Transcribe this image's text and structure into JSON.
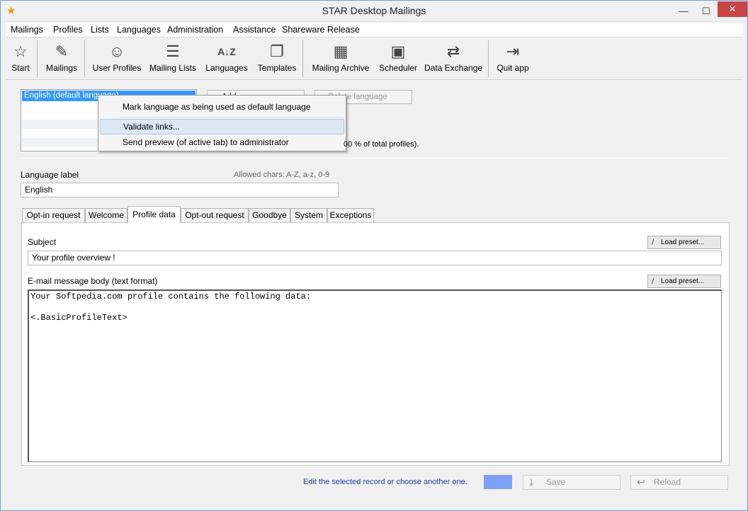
{
  "window": {
    "title": "STAR Desktop Mailings",
    "min_icon": "minimize-icon",
    "max_icon": "maximize-icon",
    "close_icon": "close-icon"
  },
  "menu": [
    "Mailings",
    "Profiles",
    "Lists",
    "Languages",
    "Administration",
    "Assistance",
    "Shareware Release"
  ],
  "toolbar": {
    "start": "Start",
    "mailings": "Mailings",
    "user_profiles": "User Profiles",
    "mailing_lists": "Mailing Lists",
    "languages": "Languages",
    "templates": "Templates",
    "mailing_archive": "Mailing Archive",
    "scheduler": "Scheduler",
    "data_exchange": "Data Exchange",
    "quit_app": "Quit app"
  },
  "language_list": {
    "items": [
      "English (default language)"
    ]
  },
  "buttons": {
    "add_language": "Add",
    "delete_language": "Delete language"
  },
  "context_menu": {
    "items": [
      "Mark language as being used as default language",
      "Validate links...",
      "Send preview (of active tab) to administrator"
    ]
  },
  "profiles_text": "00 % of total profiles).",
  "form": {
    "language_label": "Language label",
    "allowed_chars": "Allowed chars: A-Z, a-z, 0-9",
    "language_value": "English"
  },
  "tabs": [
    "Opt-in request",
    "Welcome",
    "Profile data",
    "Opt-out request",
    "Goodbye",
    "System",
    "Exceptions"
  ],
  "panel": {
    "subject_label": "Subject",
    "subject_value": "Your profile overview !",
    "load_preset": "Load preset...",
    "body_label": "E-mail message body (text format)",
    "body_text": "Your Softpedia.com profile contains the following data:\n\n<.BasicProfileText>"
  },
  "footer": {
    "hint": "Edit the selected record or choose another one.",
    "save": "Save",
    "reload": "Reload",
    "color": "#7ca0f8"
  }
}
